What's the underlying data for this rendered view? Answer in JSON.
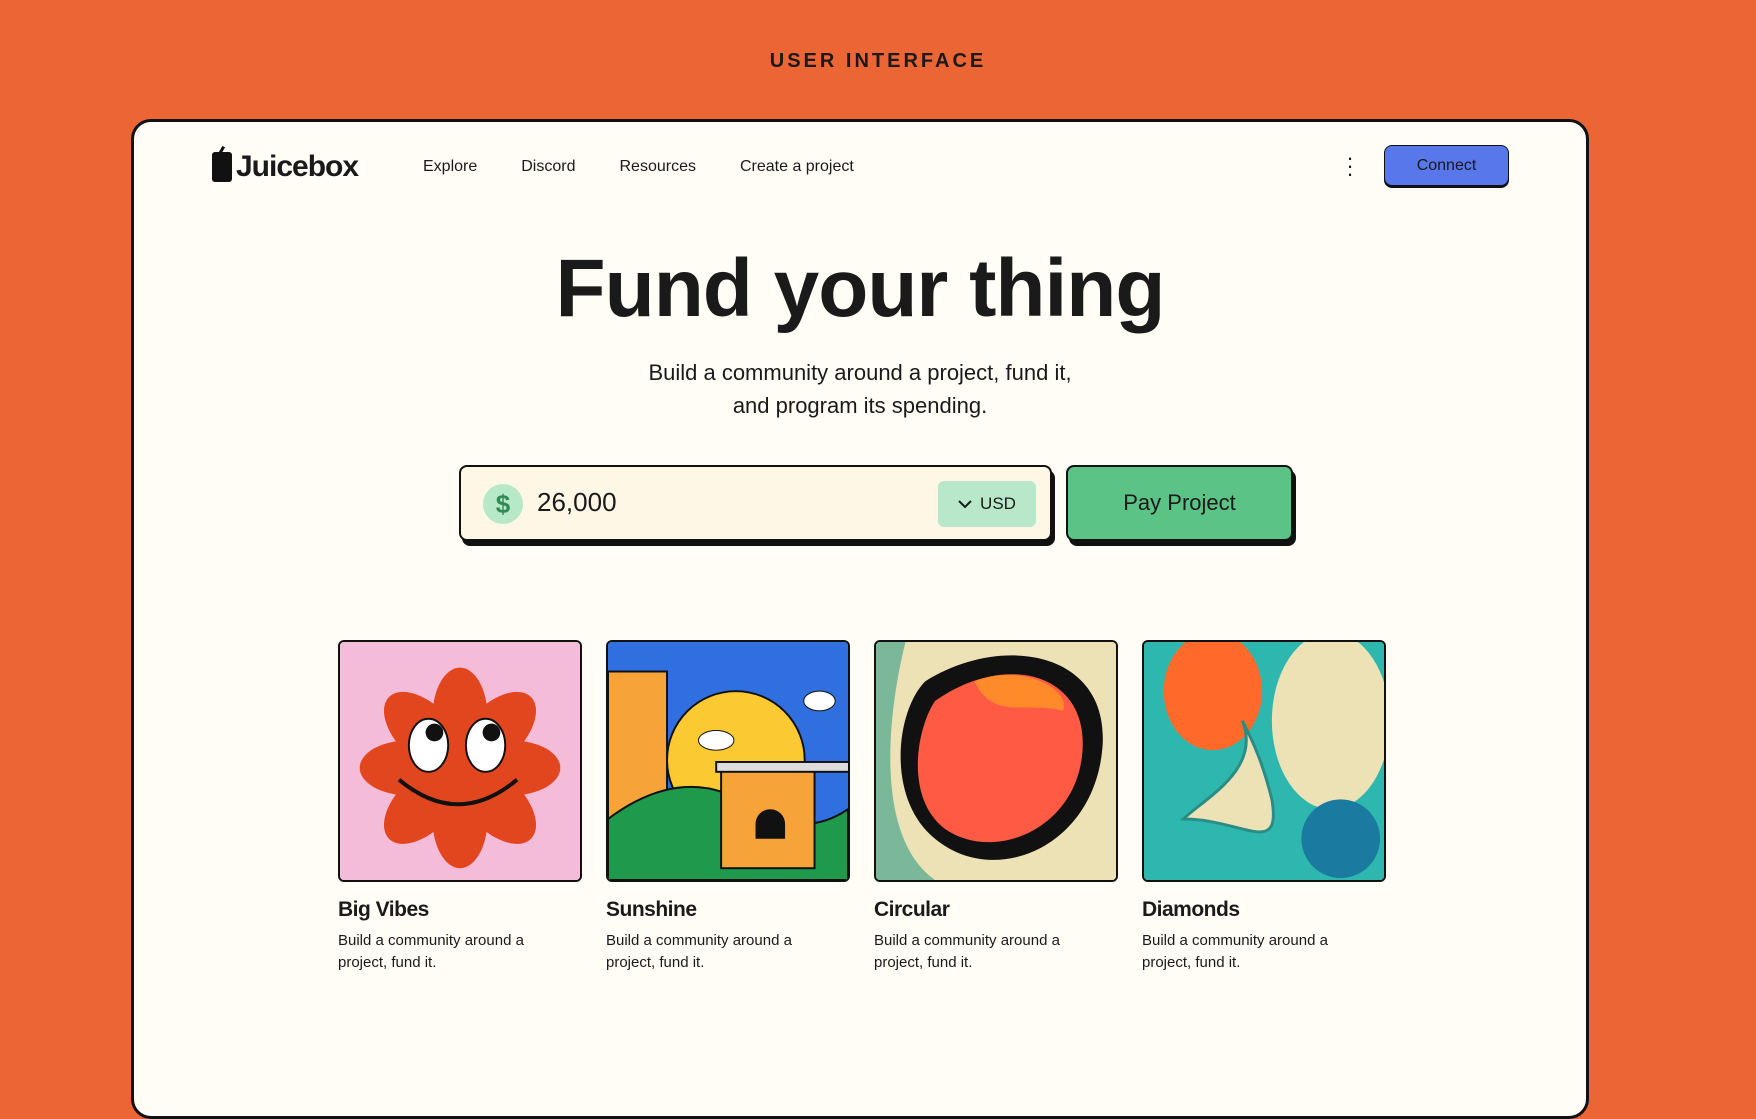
{
  "page_title": "USER INTERFACE",
  "nav": {
    "logo": "Juicebox",
    "items": [
      "Explore",
      "Discord",
      "Resources",
      "Create a project"
    ],
    "connect": "Connect"
  },
  "hero": {
    "title": "Fund your thing",
    "subtitle_line1": "Build a community around a project, fund it,",
    "subtitle_line2": "and program its spending."
  },
  "payment": {
    "amount": "26,000",
    "currency": "USD",
    "pay_label": "Pay Project"
  },
  "projects": [
    {
      "title": "Big Vibes",
      "description": "Build a community around a project, fund it."
    },
    {
      "title": "Sunshine",
      "description": "Build a community around a project, fund it."
    },
    {
      "title": "Circular",
      "description": "Build a community around a project, fund it."
    },
    {
      "title": "Diamonds",
      "description": "Build a community around a project, fund it."
    }
  ],
  "colors": {
    "background": "#ec6535",
    "accent": "#5777eb",
    "pay": "#5cc387"
  }
}
